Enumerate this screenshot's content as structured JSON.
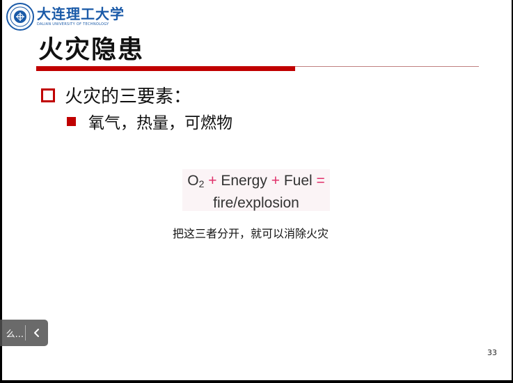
{
  "logo": {
    "name_cn": "大连理工大学",
    "name_en": "DALIAN UNIVERSITY OF TECHNOLOGY",
    "brand_color": "#1a5aa8"
  },
  "slide": {
    "title": "火灾隐患",
    "accent_color": "#c00000",
    "bullet_1": "火灾的三要素：",
    "bullet_2": "氧气，热量，可燃物",
    "equation": {
      "o": "O",
      "o_sub": "2",
      "plus_1": "+",
      "energy": "Energy",
      "plus_2": "+",
      "fuel": "Fuel",
      "equals": "=",
      "result": "fire/explosion"
    },
    "note": "把这三者分开，就可以消除火灾",
    "page_number": "33"
  },
  "overlay": {
    "text": "么...",
    "collapse_icon": "chevron-left-icon"
  }
}
